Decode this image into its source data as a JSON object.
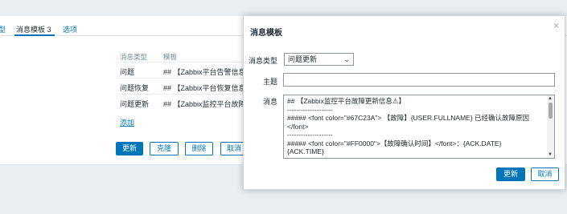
{
  "tabs": [
    {
      "label": "型"
    },
    {
      "label": "消息模板 3"
    },
    {
      "label": "选项"
    }
  ],
  "templates_table": {
    "headers": {
      "type": "消息类型",
      "template": "模板"
    },
    "rows": [
      {
        "type": "问题",
        "template": "## 【Zabbix平台告警信息"
      },
      {
        "type": "问题恢复",
        "template": "## 【Zabbix平台恢复信息"
      },
      {
        "type": "问题更新",
        "template": "## 【Zabbix监控平台故障"
      }
    ],
    "add_link": "添加"
  },
  "background_buttons": {
    "update": "更新",
    "clone": "克隆",
    "delete": "删除",
    "cancel": "取消"
  },
  "dialog": {
    "title": "消息模板",
    "close_symbol": "×",
    "message_type_label": "消息类型",
    "message_type_value": "问题更新",
    "subject_label": "主题",
    "subject_value": "",
    "message_label": "消息",
    "message_lines": [
      "## 【Zabbix监控平台故障更新信息⚠】",
      "--------------------",
      "##### <font color=\"#67C23A\"> 【故障】{USER.FULLNAME} 已经确认故障原因",
      "</font>",
      "--------------------",
      "##### <font color=\"#FF0000\">【故障确认时间】</font>：{ACK.DATE}",
      "{ACK.TIME}"
    ],
    "update_button": "更新",
    "cancel_button": "取消"
  },
  "colors": {
    "accent": "#0275b8",
    "background": "#ebeef0"
  }
}
